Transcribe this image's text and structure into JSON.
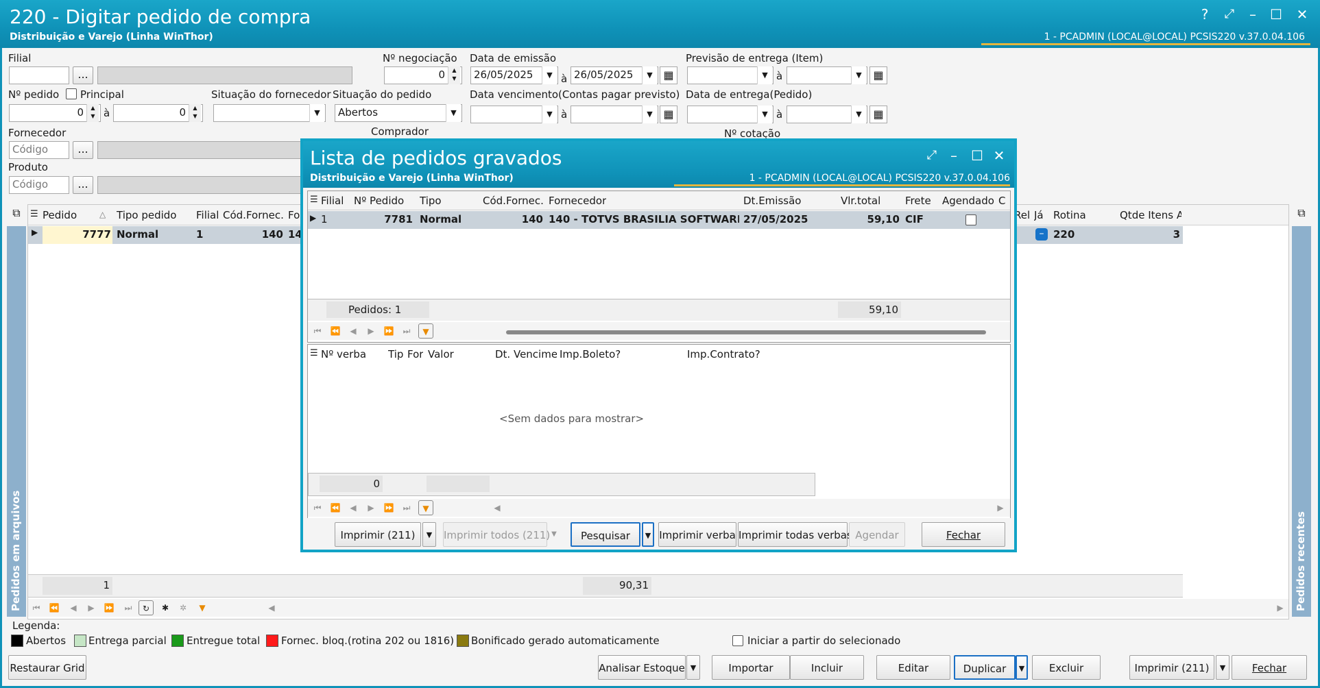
{
  "window": {
    "title": "220 - Digitar pedido de compra",
    "subtitle": "Distribuição e Varejo (Linha WinThor)",
    "user_info": "1 - PCADMIN (LOCAL@LOCAL)   PCSIS220  v.37.0.04.106",
    "controls": [
      "?",
      "⤢",
      "–",
      "☐",
      "✕"
    ]
  },
  "filters": {
    "filial_label": "Filial",
    "ellipsis": "...",
    "negociacao_label": "Nº negociação",
    "negociacao_value": "0",
    "emissao_label": "Data de emissão",
    "emissao_from": "26/05/2025",
    "emissao_to": "26/05/2025",
    "a": "à",
    "previsao_label": "Previsão  de entrega (Item)",
    "pedido_label": "Nº pedido",
    "principal_label": "Principal",
    "pedido_from": "0",
    "pedido_to": "0",
    "sit_fornecedor_label": "Situação do fornecedor",
    "sit_pedido_label": "Situação do pedido",
    "sit_pedido_value": "Abertos",
    "vencimento_label": "Data vencimento(Contas pagar previsto)",
    "entrega_label": "Data de entrega(Pedido)",
    "fornecedor_label": "Fornecedor",
    "comprador_label": "Comprador",
    "cotacao_label": "Nº cotação",
    "produto_label": "Produto",
    "codigo_placeholder": "Código"
  },
  "main_grid": {
    "headers": [
      "Pedido",
      "Tipo pedido",
      "Filial",
      "Cód.Fornec.",
      "Fo",
      "Rel",
      "Já",
      "Rotina",
      "Qtde Itens A"
    ],
    "row": {
      "pedido": "7777",
      "tipo": "Normal",
      "filial": "1",
      "codfornec": "140",
      "fo": "14",
      "rotina": "220",
      "qtde": "3"
    },
    "footer_count": "1",
    "footer_total": "90,31"
  },
  "side_labels": {
    "left": "Pedidos em arquivos",
    "right": "Pedidos recentes"
  },
  "legend": {
    "title": "Legenda:",
    "items": [
      {
        "label": "Abertos",
        "color": "#000000"
      },
      {
        "label": "Entrega parcial",
        "color": "#c6e6c6"
      },
      {
        "label": "Entregue total",
        "color": "#1a9a1a"
      },
      {
        "label": "Fornec. bloq.(rotina 202 ou 1816)",
        "color": "#ff1a1a"
      },
      {
        "label": "Bonificado gerado automaticamente",
        "color": "#8a7a10"
      }
    ],
    "iniciar_label": "Iniciar a partir do selecionado"
  },
  "bottom_buttons": {
    "restaurar": "Restaurar Grid",
    "analisar": "Analisar Estoque",
    "importar": "Importar",
    "incluir": "Incluir",
    "editar": "Editar",
    "duplicar": "Duplicar",
    "excluir": "Excluir",
    "imprimir": "Imprimir (211)",
    "fechar": "Fechar"
  },
  "modal": {
    "title": "Lista de pedidos gravados",
    "subtitle": "Distribuição e Varejo (Linha WinThor)",
    "user_info": "1 - PCADMIN (LOCAL@LOCAL)   PCSIS220  v.37.0.04.106",
    "grid_headers": [
      "Filial",
      "Nº Pedido",
      "Tipo",
      "Cód.Fornec.",
      "Fornecedor",
      "Dt.Emissão",
      "Vlr.total",
      "Frete",
      "Agendado",
      "C"
    ],
    "row": {
      "filial": "1",
      "pedido": "7781",
      "tipo": "Normal",
      "codfornec": "140",
      "fornecedor": "140 - TOTVS BRASILIA SOFTWARI",
      "emissao": "27/05/2025",
      "total": "59,10",
      "frete": "CIF"
    },
    "footer_count": "Pedidos: 1",
    "footer_total": "59,10",
    "verba_headers": [
      "Nº verba",
      "Tip",
      "For",
      "Valor",
      "Dt. Vencimer",
      "Imp.Boleto?",
      "Imp.Contrato?"
    ],
    "empty_text": "<Sem dados para mostrar>",
    "verba_footer": "0",
    "buttons": {
      "imprimir": "Imprimir (211)",
      "imprimir_todos": "Imprimir todos (211)",
      "pesquisar": "Pesquisar",
      "imprimir_verba": "Imprimir verba",
      "imprimir_todas": "Imprimir todas verbas",
      "agendar": "Agendar",
      "fechar": "Fechar"
    }
  }
}
